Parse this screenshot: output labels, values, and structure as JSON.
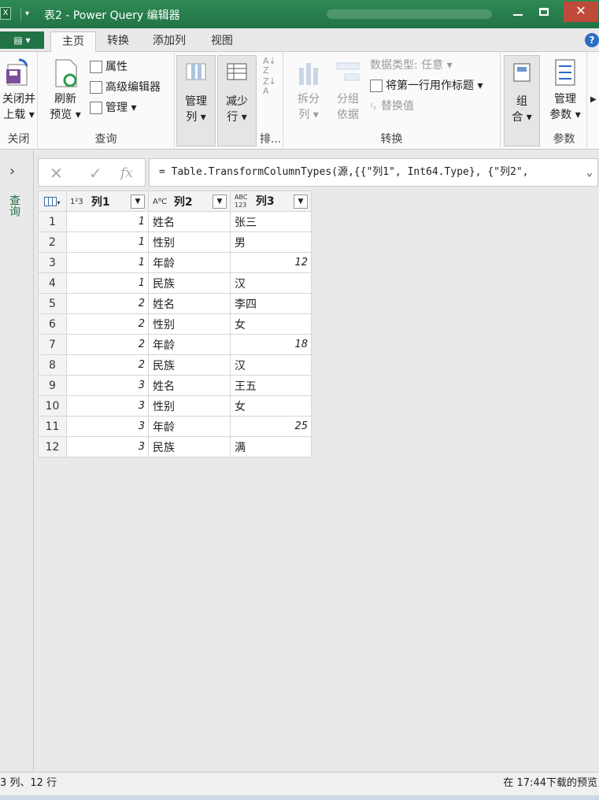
{
  "window": {
    "title": "表2 - Power Query 编辑器",
    "app_icon": "X"
  },
  "tabs": {
    "file_label": "▤ ▾",
    "items": [
      {
        "label": "主页",
        "active": true
      },
      {
        "label": "转换",
        "active": false
      },
      {
        "label": "添加列",
        "active": false
      },
      {
        "label": "视图",
        "active": false
      }
    ]
  },
  "ribbon": {
    "close": {
      "btn": "关闭并\n上载",
      "line1": "关闭并",
      "line2": "上载 ▾",
      "group": "关闭"
    },
    "query": {
      "refresh_l1": "刷新",
      "refresh_l2": "预览 ▾",
      "properties": "属性",
      "advanced_editor": "高级编辑器",
      "manage": "管理 ▾",
      "group": "查询"
    },
    "manage_columns": {
      "l1": "管理",
      "l2": "列 ▾"
    },
    "reduce_rows": {
      "l1": "减少",
      "l2": "行 ▾"
    },
    "sort": {
      "group": "排..."
    },
    "transform": {
      "split_l1": "拆分",
      "split_l2": "列 ▾",
      "group_by_l1": "分组",
      "group_by_l2": "依据",
      "data_type": "数据类型: 任意 ▾",
      "first_row_header": "将第一行用作标题 ▾",
      "replace_values": "替换值",
      "group": "转换"
    },
    "combine": {
      "l1": "组",
      "l2": "合 ▾"
    },
    "parameters": {
      "l1": "管理",
      "l2": "参数 ▾",
      "group": "参数"
    }
  },
  "sidebar": {
    "label": "查询"
  },
  "formula": {
    "text": "= Table.TransformColumnTypes(源,{{\"列1\", Int64.Type}, {\"列2\","
  },
  "table": {
    "columns": [
      {
        "name": "列1",
        "type_icon": "1²3"
      },
      {
        "name": "列2",
        "type_icon": "AᴮC"
      },
      {
        "name": "列3",
        "type_icon": "ABC 123"
      }
    ],
    "rows": [
      {
        "n": "1",
        "c1": "1",
        "c2": "姓名",
        "c3": "张三",
        "num": false
      },
      {
        "n": "2",
        "c1": "1",
        "c2": "性别",
        "c3": "男",
        "num": false
      },
      {
        "n": "3",
        "c1": "1",
        "c2": "年龄",
        "c3": "12",
        "num": true
      },
      {
        "n": "4",
        "c1": "1",
        "c2": "民族",
        "c3": "汉",
        "num": false
      },
      {
        "n": "5",
        "c1": "2",
        "c2": "姓名",
        "c3": "李四",
        "num": false
      },
      {
        "n": "6",
        "c1": "2",
        "c2": "性别",
        "c3": "女",
        "num": false
      },
      {
        "n": "7",
        "c1": "2",
        "c2": "年龄",
        "c3": "18",
        "num": true
      },
      {
        "n": "8",
        "c1": "2",
        "c2": "民族",
        "c3": "汉",
        "num": false
      },
      {
        "n": "9",
        "c1": "3",
        "c2": "姓名",
        "c3": "王五",
        "num": false
      },
      {
        "n": "10",
        "c1": "3",
        "c2": "性别",
        "c3": "女",
        "num": false
      },
      {
        "n": "11",
        "c1": "3",
        "c2": "年龄",
        "c3": "25",
        "num": true
      },
      {
        "n": "12",
        "c1": "3",
        "c2": "民族",
        "c3": "满",
        "num": false
      }
    ]
  },
  "status": {
    "left": "3 列、12 行",
    "right": "在 17:44下载的预览"
  },
  "colors": {
    "accent": "#217346",
    "help": "#2b6cc4",
    "close": "#c04a3a"
  }
}
